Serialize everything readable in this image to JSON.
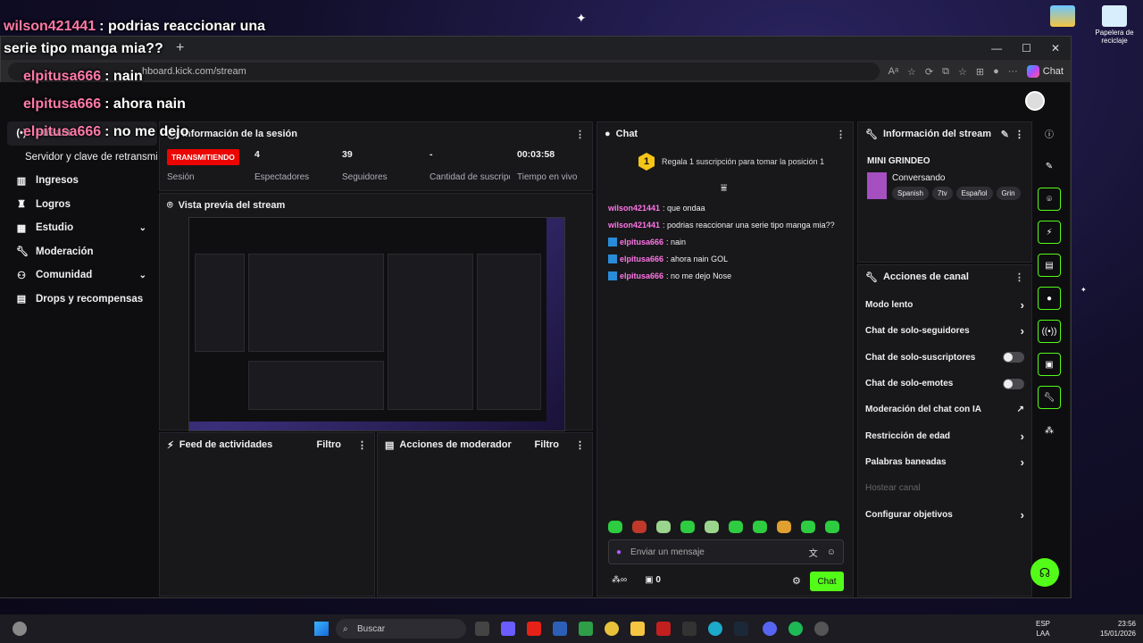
{
  "overlay_chat": [
    {
      "user": "wilson421441",
      "text": ": podrias reaccionar una",
      "cont": "serie tipo manga mia??"
    },
    {
      "user": "elpitusa666",
      "text": ": nain"
    },
    {
      "user": "elpitusa666",
      "text": ": ahora nain"
    },
    {
      "user": "elpitusa666",
      "text": ": no me dejo"
    }
  ],
  "browser": {
    "url": "hboard.kick.com/stream",
    "chat_label": "Chat"
  },
  "desktop": {
    "recycle_label": "Papelera de reciclaje"
  },
  "sidebar": {
    "items": [
      {
        "label": "Stream",
        "icon": "stream-icon"
      },
      {
        "label": "Servidor y clave de retransmisión",
        "icon": ""
      },
      {
        "label": "Ingresos",
        "icon": "bar-chart-icon"
      },
      {
        "label": "Logros",
        "icon": "trophy-icon"
      },
      {
        "label": "Estudio",
        "icon": "grid-icon"
      },
      {
        "label": "Moderación",
        "icon": "wrench-icon"
      },
      {
        "label": "Comunidad",
        "icon": "users-icon"
      },
      {
        "label": "Drops y recompensas",
        "icon": "drops-icon"
      }
    ]
  },
  "session": {
    "title": "Información de la sesión",
    "live_badge": "TRANSMITIENDO",
    "session_label": "Sesión",
    "stats": [
      {
        "value": "4",
        "label": "Espectadores"
      },
      {
        "value": "39",
        "label": "Seguidores"
      },
      {
        "value": "-",
        "label": "Cantidad de suscripciones"
      },
      {
        "value": "00:03:58",
        "label": "Tiempo en vivo"
      }
    ]
  },
  "preview": {
    "title": "Vista previa del stream"
  },
  "activity": {
    "title": "Feed de actividades",
    "filter": "Filtro"
  },
  "mod_actions": {
    "title": "Acciones de moderador",
    "filter": "Filtro"
  },
  "chat": {
    "title": "Chat",
    "gift_rank": "1",
    "gift_text": "Regala 1 suscripción para tomar la posición 1",
    "messages": [
      {
        "user": "wilson421441",
        "text": ": que ondaa",
        "badge": false
      },
      {
        "user": "wilson421441",
        "text": ": podrias reaccionar una serie tipo manga mia??",
        "badge": false
      },
      {
        "user": "elpitusa666",
        "text": ": nain",
        "badge": true
      },
      {
        "user": "elpitusa666",
        "text": ": ahora nain GOL",
        "badge": true
      },
      {
        "user": "elpitusa666",
        "text": ": no me dejo Nose",
        "badge": true
      }
    ],
    "placeholder": "Enviar un mensaje",
    "points": "0",
    "send_label": "Chat"
  },
  "stream_info": {
    "title": "Información del stream",
    "stream_title": "MINI GRINDEO",
    "category": "Conversando",
    "tags": [
      "Spanish",
      "7tv",
      "Español",
      "Grin"
    ]
  },
  "channel_actions": {
    "title": "Acciones de canal",
    "items": [
      {
        "label": "Modo lento",
        "control": "chevron"
      },
      {
        "label": "Chat de solo-seguidores",
        "control": "chevron"
      },
      {
        "label": "Chat de solo-suscriptores",
        "control": "toggle"
      },
      {
        "label": "Chat de solo-emotes",
        "control": "toggle"
      },
      {
        "label": "Moderación del chat con IA",
        "control": "external"
      },
      {
        "label": "Restricción de edad",
        "control": "chevron"
      },
      {
        "label": "Palabras baneadas",
        "control": "chevron"
      },
      {
        "label": "Hostear canal",
        "control": "disabled"
      },
      {
        "label": "Configurar objetivos",
        "control": "chevron"
      }
    ]
  },
  "taskbar": {
    "search": "Buscar",
    "lang": "ESP",
    "lang_sub": "LAA",
    "time": "23:56",
    "date": "15/01/2026"
  },
  "colors": {
    "kick_green": "#53fc18",
    "live_red": "#eb0400",
    "chat_user": "#ff75e6"
  }
}
